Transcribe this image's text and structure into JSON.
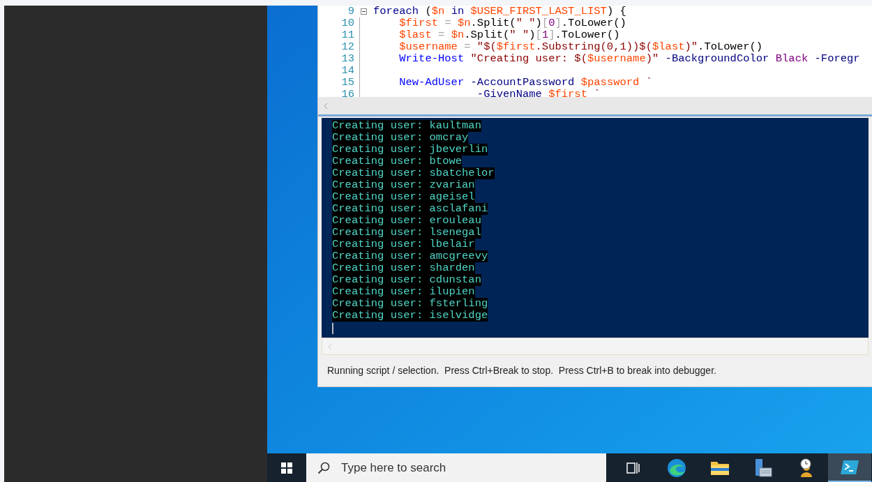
{
  "editor": {
    "lines": [
      {
        "number": "9",
        "fold": true,
        "tokens": [
          {
            "kind": "keyword",
            "text": "foreach"
          },
          {
            "kind": "plain",
            "text": " ("
          },
          {
            "kind": "variable",
            "text": "$n"
          },
          {
            "kind": "keyword",
            "text": " in "
          },
          {
            "kind": "variable",
            "text": "$USER_FIRST_LAST_LIST"
          },
          {
            "kind": "plain",
            "text": ") {"
          }
        ]
      },
      {
        "number": "10",
        "fold": false,
        "tokens": [
          {
            "kind": "variable",
            "text": "    $first"
          },
          {
            "kind": "operator",
            "text": " = "
          },
          {
            "kind": "variable",
            "text": "$n"
          },
          {
            "kind": "plain",
            "text": ".Split("
          },
          {
            "kind": "string",
            "text": "\" \""
          },
          {
            "kind": "plain",
            "text": ")"
          },
          {
            "kind": "operator",
            "text": "["
          },
          {
            "kind": "number",
            "text": "0"
          },
          {
            "kind": "operator",
            "text": "]"
          },
          {
            "kind": "plain",
            "text": ".ToLower()"
          }
        ]
      },
      {
        "number": "11",
        "fold": false,
        "tokens": [
          {
            "kind": "variable",
            "text": "    $last"
          },
          {
            "kind": "operator",
            "text": " = "
          },
          {
            "kind": "variable",
            "text": "$n"
          },
          {
            "kind": "plain",
            "text": ".Split("
          },
          {
            "kind": "string",
            "text": "\" \""
          },
          {
            "kind": "plain",
            "text": ")"
          },
          {
            "kind": "operator",
            "text": "["
          },
          {
            "kind": "number",
            "text": "1"
          },
          {
            "kind": "operator",
            "text": "]"
          },
          {
            "kind": "plain",
            "text": ".ToLower()"
          }
        ]
      },
      {
        "number": "12",
        "fold": false,
        "tokens": [
          {
            "kind": "variable",
            "text": "    $username"
          },
          {
            "kind": "operator",
            "text": " = "
          },
          {
            "kind": "string",
            "text": "\"$("
          },
          {
            "kind": "variable",
            "text": "$first"
          },
          {
            "kind": "string",
            "text": ".Substring(0,1))$("
          },
          {
            "kind": "variable",
            "text": "$last"
          },
          {
            "kind": "string",
            "text": ")\""
          },
          {
            "kind": "plain",
            "text": ".ToLower()"
          }
        ]
      },
      {
        "number": "13",
        "fold": false,
        "tokens": [
          {
            "kind": "command",
            "text": "    Write-Host"
          },
          {
            "kind": "string",
            "text": " \"Creating user: $("
          },
          {
            "kind": "variable",
            "text": "$username"
          },
          {
            "kind": "string",
            "text": ")\""
          },
          {
            "kind": "parameter",
            "text": " -BackgroundColor"
          },
          {
            "kind": "number",
            "text": " Black"
          },
          {
            "kind": "parameter",
            "text": " -Foregr"
          }
        ]
      },
      {
        "number": "14",
        "fold": false
      },
      {
        "number": "15",
        "fold": false,
        "tokens": [
          {
            "kind": "command",
            "text": "    New-AdUser"
          },
          {
            "kind": "parameter",
            "text": " -AccountPassword"
          },
          {
            "kind": "variable",
            "text": " $password"
          },
          {
            "kind": "string",
            "text": " `"
          }
        ]
      },
      {
        "number": "16",
        "fold": false,
        "tokens": [
          {
            "kind": "parameter",
            "text": "                -GivenName"
          },
          {
            "kind": "variable",
            "text": " $first"
          },
          {
            "kind": "string",
            "text": " `"
          }
        ]
      }
    ]
  },
  "console": {
    "lines": [
      "Creating user: kaultman",
      "Creating user: omcray",
      "Creating user: jbeverlin",
      "Creating user: btowe",
      "Creating user: sbatchelor",
      "Creating user: zvarian",
      "Creating user: ageisel",
      "Creating user: asclafani",
      "Creating user: erouleau",
      "Creating user: lsenegal",
      "Creating user: lbelair",
      "Creating user: amcgreevy",
      "Creating user: sharden",
      "Creating user: cdunstan",
      "Creating user: ilupien",
      "Creating user: fsterling",
      "Creating user: iselvidge"
    ]
  },
  "status_bar": "Running script / selection.  Press Ctrl+Break to stop.  Press Ctrl+B to break into debugger.",
  "taskbar": {
    "search": {
      "placeholder": "Type here to search"
    },
    "apps": [
      {
        "kind": "task-view",
        "selected": false
      },
      {
        "kind": "browser",
        "selected": false
      },
      {
        "kind": "folder",
        "selected": false
      },
      {
        "kind": "server",
        "selected": false
      },
      {
        "kind": "user-clock",
        "selected": false
      },
      {
        "kind": "terminal",
        "selected": true
      }
    ]
  }
}
